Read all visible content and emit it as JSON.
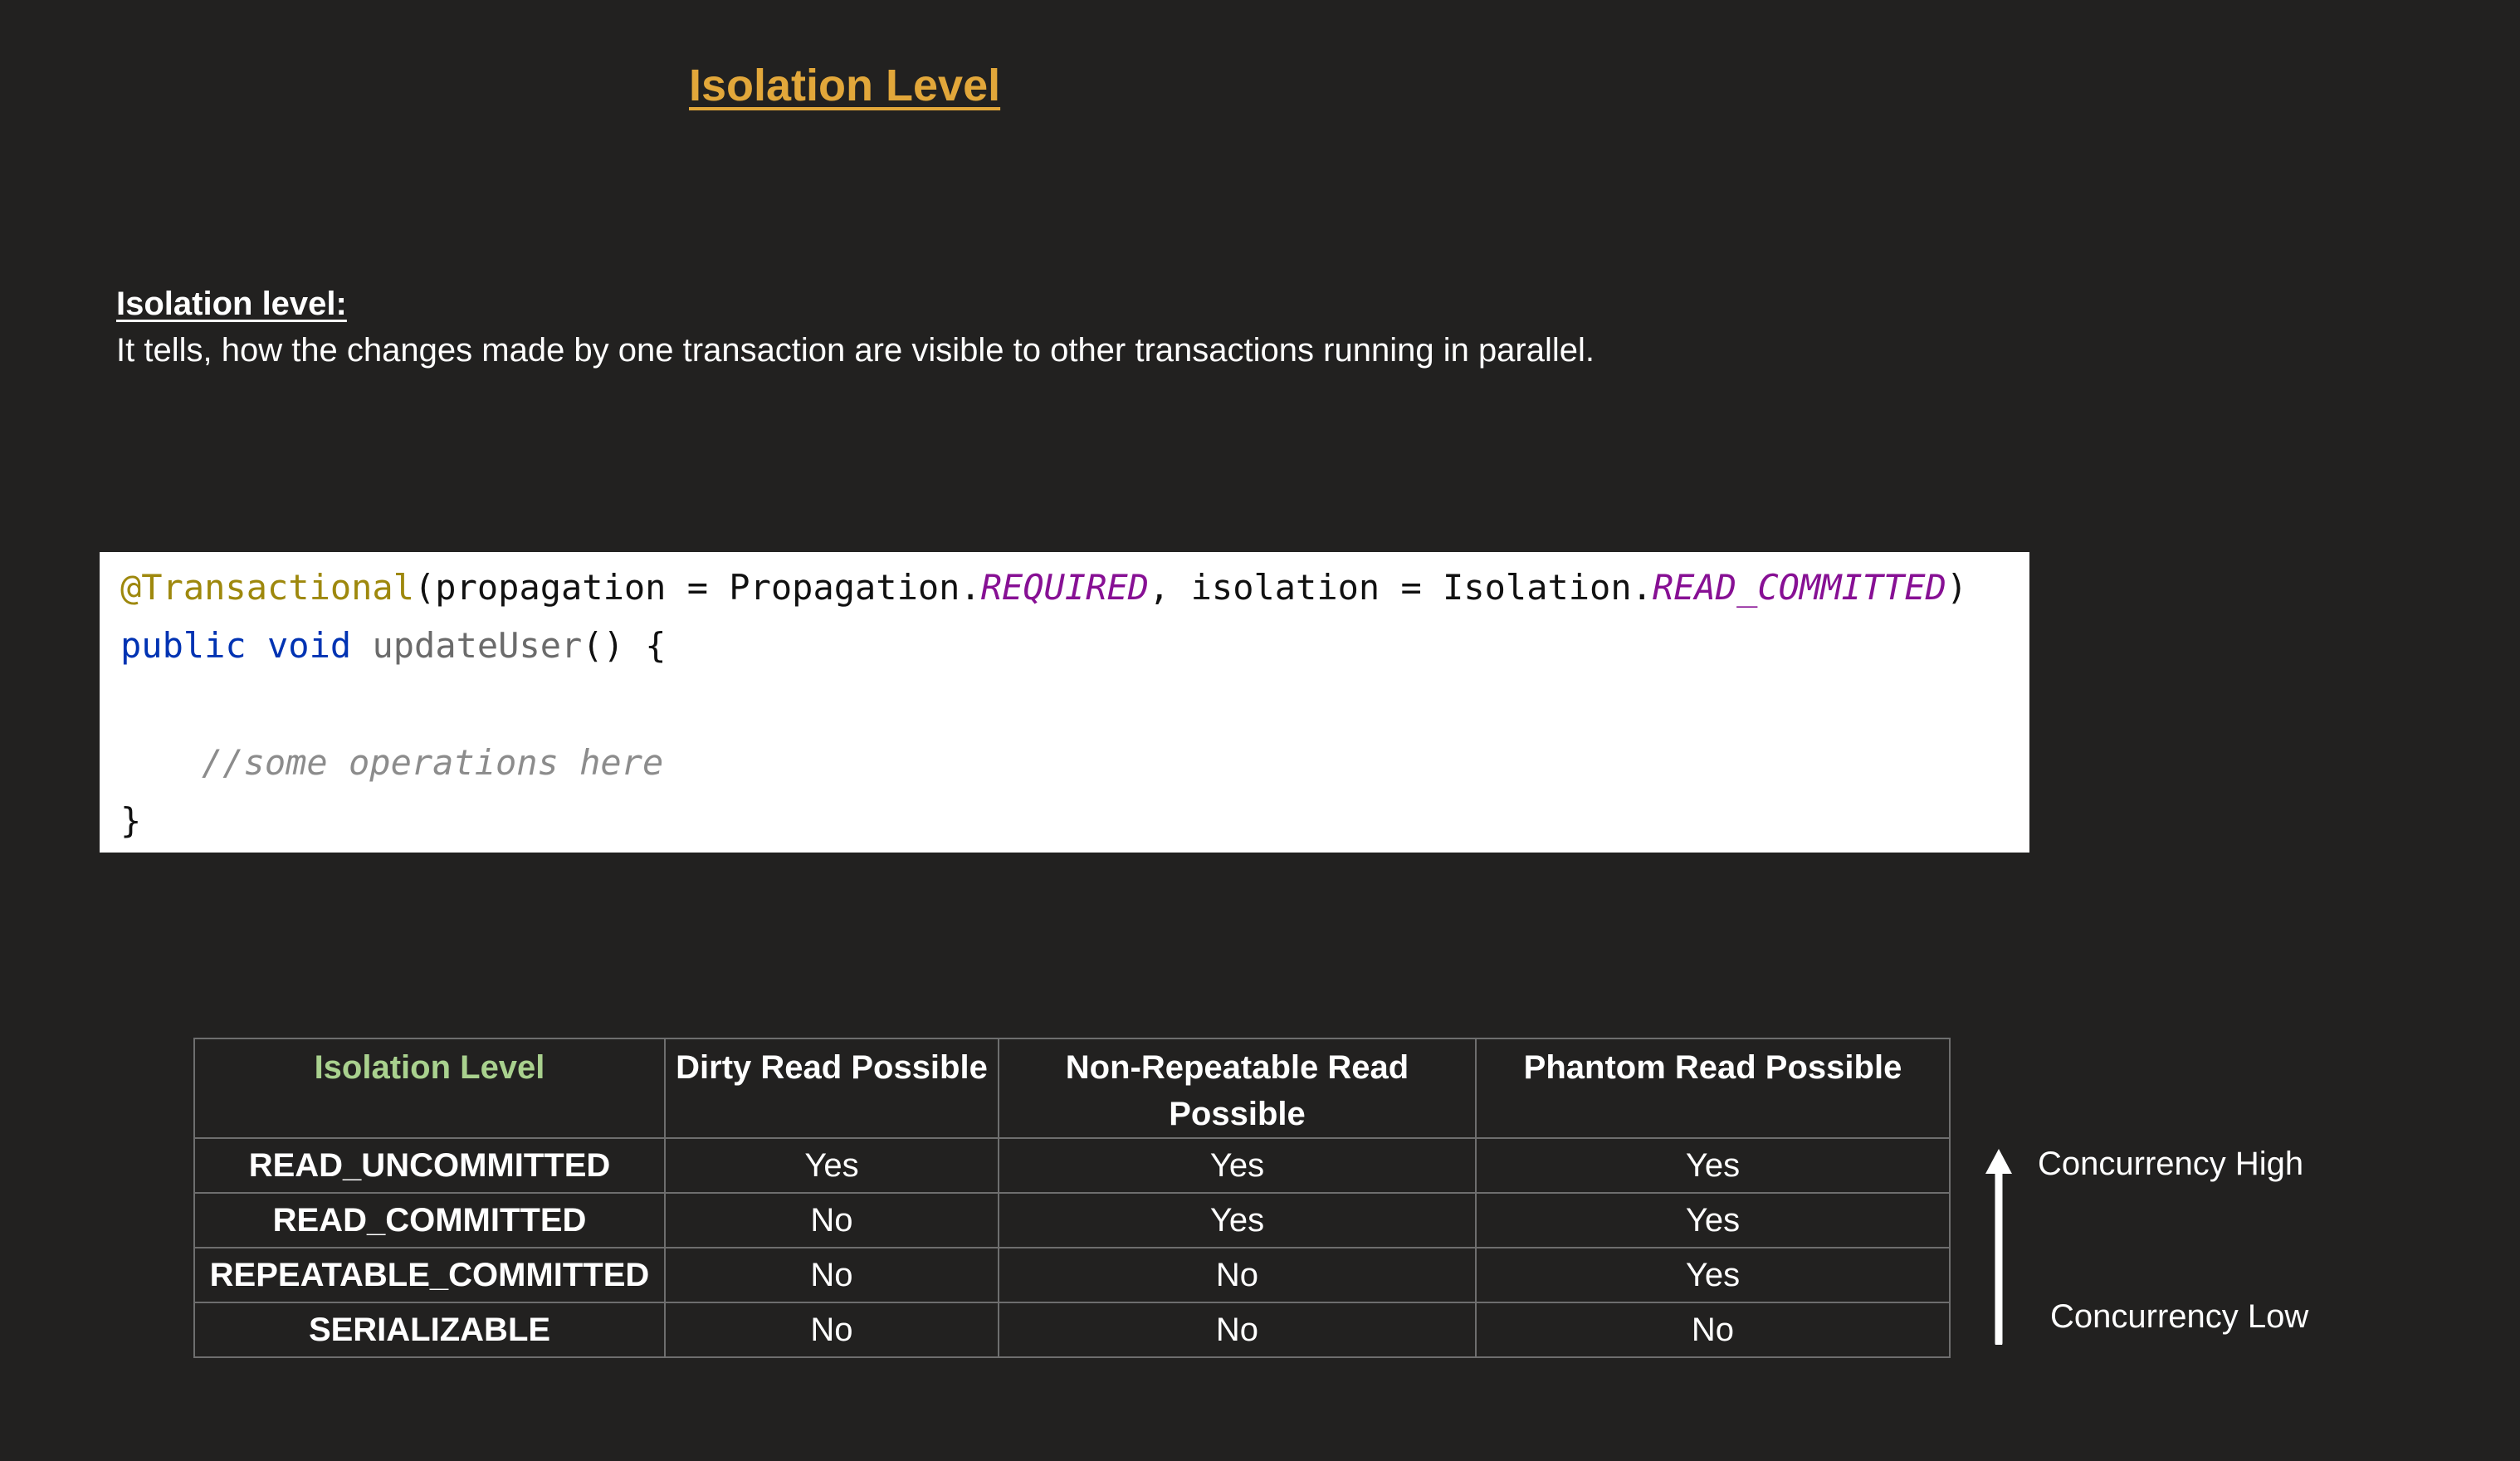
{
  "title": "Isolation Level",
  "definition": {
    "heading": "Isolation level:",
    "text": "It tells, how the changes made by one transaction are visible to other transactions running in parallel."
  },
  "code": {
    "annotation": "@Transactional",
    "line1_a": "(propagation = Propagation.",
    "line1_prop": "REQUIRED",
    "line1_b": ", isolation = Isolation.",
    "line1_iso": "READ_COMMITTED",
    "line1_c": ")",
    "kw_public": "public",
    "kw_void": "void",
    "method": "updateUser",
    "line2_rest": "() {",
    "comment": "//some operations here",
    "closing": "}"
  },
  "table": {
    "headers": [
      "Isolation Level",
      "Dirty Read Possible",
      "Non-Repeatable Read Possible",
      "Phantom Read Possible"
    ],
    "rows": [
      [
        "READ_UNCOMMITTED",
        "Yes",
        "Yes",
        "Yes"
      ],
      [
        "READ_COMMITTED",
        "No",
        "Yes",
        "Yes"
      ],
      [
        "REPEATABLE_COMMITTED",
        "No",
        "No",
        "Yes"
      ],
      [
        "SERIALIZABLE",
        "No",
        "No",
        "No"
      ]
    ]
  },
  "concurrency": {
    "high": "Concurrency High",
    "low": "Concurrency Low"
  },
  "colors": {
    "background": "#222120",
    "title": "#e2a73a",
    "header_first_col": "#a9d18e",
    "annotation": "#9e880d",
    "constant": "#871094",
    "keyword": "#0033b3"
  }
}
